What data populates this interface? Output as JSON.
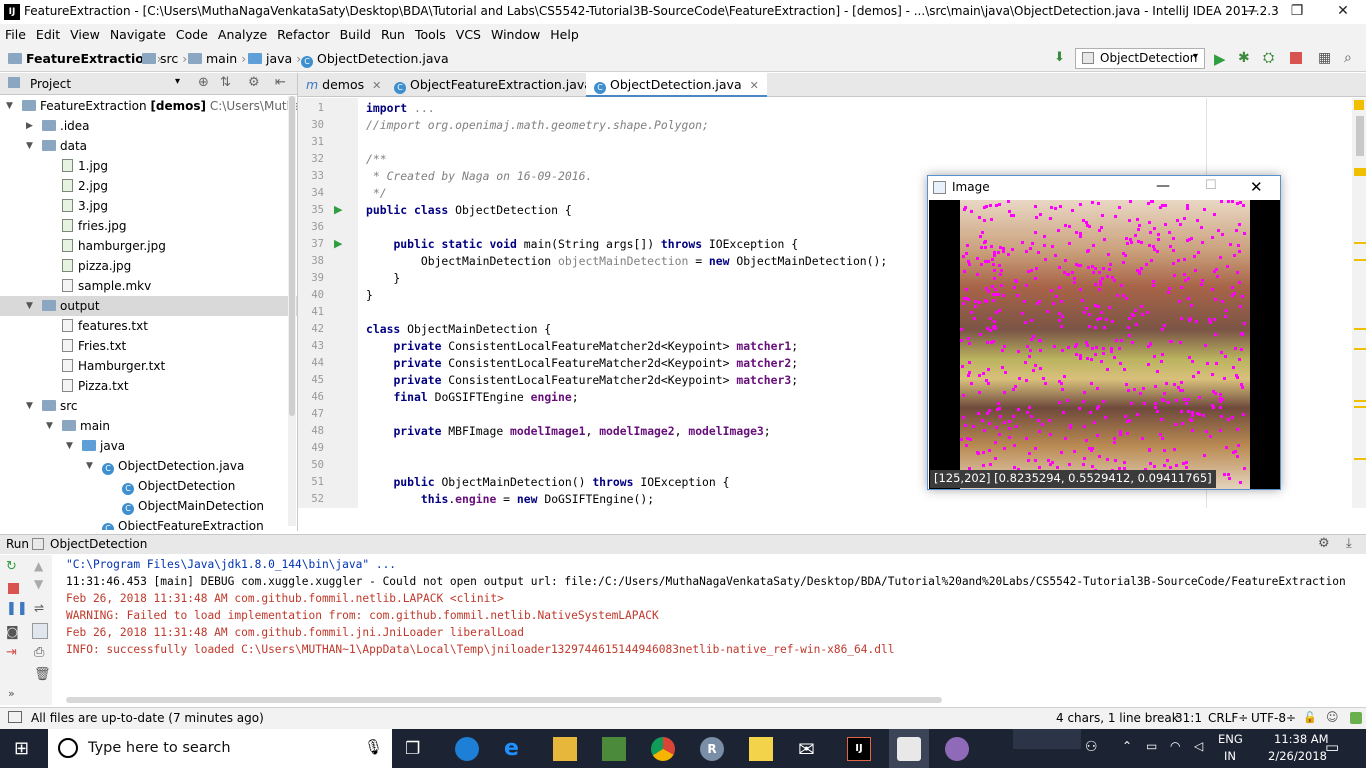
{
  "window": {
    "title": "FeatureExtraction - [C:\\Users\\MuthaNagaVenkataSaty\\Desktop\\BDA\\Tutorial and Labs\\CS5542-Tutorial3B-SourceCode\\FeatureExtraction] - [demos] - ...\\src\\main\\java\\ObjectDetection.java - IntelliJ IDEA 2017.2.3"
  },
  "menu": [
    "File",
    "Edit",
    "View",
    "Navigate",
    "Code",
    "Analyze",
    "Refactor",
    "Build",
    "Run",
    "Tools",
    "VCS",
    "Window",
    "Help"
  ],
  "breadcrumb": {
    "project": "FeatureExtraction",
    "parts": [
      "src",
      "main",
      "java"
    ],
    "file": "ObjectDetection.java"
  },
  "run_config": "ObjectDetection",
  "project_panel": {
    "title": "Project",
    "root_name": "FeatureExtraction",
    "root_module": "[demos]",
    "root_path": "C:\\Users\\MuthaNaga",
    "items": [
      {
        "label": ".idea",
        "type": "folder",
        "depth": 1,
        "expanded": false
      },
      {
        "label": "data",
        "type": "folder",
        "depth": 1,
        "expanded": true
      },
      {
        "label": "1.jpg",
        "type": "image",
        "depth": 2
      },
      {
        "label": "2.jpg",
        "type": "image",
        "depth": 2
      },
      {
        "label": "3.jpg",
        "type": "image",
        "depth": 2
      },
      {
        "label": "fries.jpg",
        "type": "image",
        "depth": 2
      },
      {
        "label": "hamburger.jpg",
        "type": "image",
        "depth": 2
      },
      {
        "label": "pizza.jpg",
        "type": "image",
        "depth": 2
      },
      {
        "label": "sample.mkv",
        "type": "file",
        "depth": 2
      },
      {
        "label": "output",
        "type": "folder",
        "depth": 1,
        "expanded": true,
        "selected": true
      },
      {
        "label": "features.txt",
        "type": "text",
        "depth": 2
      },
      {
        "label": "Fries.txt",
        "type": "text",
        "depth": 2
      },
      {
        "label": "Hamburger.txt",
        "type": "text",
        "depth": 2
      },
      {
        "label": "Pizza.txt",
        "type": "text",
        "depth": 2
      },
      {
        "label": "src",
        "type": "folder",
        "depth": 1,
        "expanded": true
      },
      {
        "label": "main",
        "type": "folder",
        "depth": 2,
        "expanded": true
      },
      {
        "label": "java",
        "type": "folder-blue",
        "depth": 3,
        "expanded": true
      },
      {
        "label": "ObjectDetection.java",
        "type": "class",
        "depth": 4,
        "expanded": true
      },
      {
        "label": "ObjectDetection",
        "type": "class",
        "depth": 5
      },
      {
        "label": "ObjectMainDetection",
        "type": "class",
        "depth": 5
      },
      {
        "label": "ObjectFeatureExtraction",
        "type": "class",
        "depth": 4
      }
    ]
  },
  "tabs": [
    {
      "label": "demos",
      "active": false
    },
    {
      "label": "ObjectFeatureExtraction.java",
      "active": false
    },
    {
      "label": "ObjectDetection.java",
      "active": true
    }
  ],
  "code": [
    {
      "n": "1",
      "html": "<span class=\"kw\">import</span> <span class=\"unused\">...</span>"
    },
    {
      "n": "30",
      "html": "<span class=\"cm\">//import org.openimaj.math.geometry.shape.Polygon;</span>"
    },
    {
      "n": "31",
      "html": ""
    },
    {
      "n": "32",
      "html": "<span class=\"cm\">/**</span>"
    },
    {
      "n": "33",
      "html": "<span class=\"cm\"> * Created by Naga on 16-09-2016.</span>"
    },
    {
      "n": "34",
      "html": "<span class=\"cm\"> */</span>"
    },
    {
      "n": "35",
      "html": "<span class=\"kw\">public class</span> ObjectDetection {"
    },
    {
      "n": "36",
      "html": ""
    },
    {
      "n": "37",
      "html": "    <span class=\"kw\">public static void</span> main(String args[]) <span class=\"kw\">throws</span> IOException {"
    },
    {
      "n": "38",
      "html": "        ObjectMainDetection <span class=\"unused\">objectMainDetection</span> = <span class=\"kw\">new</span> ObjectMainDetection();"
    },
    {
      "n": "39",
      "html": "    }"
    },
    {
      "n": "40",
      "html": "}"
    },
    {
      "n": "41",
      "html": ""
    },
    {
      "n": "42",
      "html": "<span class=\"kw\">class</span> ObjectMainDetection {"
    },
    {
      "n": "43",
      "html": "    <span class=\"kw\">private</span> ConsistentLocalFeatureMatcher2d&lt;Keypoint&gt; <span class=\"fld\">matcher1</span>;"
    },
    {
      "n": "44",
      "html": "    <span class=\"kw\">private</span> ConsistentLocalFeatureMatcher2d&lt;Keypoint&gt; <span class=\"fld\">matcher2</span>;"
    },
    {
      "n": "45",
      "html": "    <span class=\"kw\">private</span> ConsistentLocalFeatureMatcher2d&lt;Keypoint&gt; <span class=\"fld\">matcher3</span>;"
    },
    {
      "n": "46",
      "html": "    <span class=\"kw\">final</span> DoGSIFTEngine <span class=\"fld\">engine</span>;"
    },
    {
      "n": "47",
      "html": ""
    },
    {
      "n": "48",
      "html": "    <span class=\"kw\">private</span> MBFImage <span class=\"fld\">modelImage1</span>, <span class=\"fld\">modelImage2</span>, <span class=\"fld\">modelImage3</span>;"
    },
    {
      "n": "49",
      "html": ""
    },
    {
      "n": "50",
      "html": ""
    },
    {
      "n": "51",
      "html": "    <span class=\"kw\">public</span> ObjectMainDetection() <span class=\"kw\">throws</span> IOException {"
    },
    {
      "n": "52",
      "html": "        <span class=\"kw\">this</span>.<span class=\"fld\">engine</span> = <span class=\"kw\">new</span> DoGSIFTEngine();"
    }
  ],
  "image_window": {
    "title": "Image",
    "pixel_info": "[125,202] [0.8235294, 0.5529412, 0.09411765]"
  },
  "run_panel": {
    "label": "Run",
    "config": "ObjectDetection",
    "lines": [
      {
        "text": "\"C:\\Program Files\\Java\\jdk1.8.0_144\\bin\\java\" ...",
        "color": "#0033b3"
      },
      {
        "text": "11:31:46.453 [main] DEBUG com.xuggle.xuggler - Could not open output url: file:/C:/Users/MuthaNagaVenkataSaty/Desktop/BDA/Tutorial%20and%20Labs/CS5542-Tutorial3B-SourceCode/FeatureExtraction",
        "color": "#000000"
      },
      {
        "text": "Feb 26, 2018 11:31:48 AM com.github.fommil.netlib.LAPACK <clinit>",
        "color": "#c0392b"
      },
      {
        "text": "WARNING: Failed to load implementation from: com.github.fommil.netlib.NativeSystemLAPACK",
        "color": "#c0392b"
      },
      {
        "text": "Feb 26, 2018 11:31:48 AM com.github.fommil.jni.JniLoader liberalLoad",
        "color": "#c0392b"
      },
      {
        "text": "INFO: successfully loaded C:\\Users\\MUTHAN~1\\AppData\\Local\\Temp\\jniloader1329744615144946083netlib-native_ref-win-x86_64.dll",
        "color": "#c0392b"
      }
    ]
  },
  "status": {
    "message": "All files are up-to-date (7 minutes ago)",
    "selection": "4 chars, 1 line break",
    "position": "31:1",
    "line_sep": "CRLF÷",
    "encoding": "UTF-8÷"
  },
  "taskbar": {
    "search_placeholder": "Type here to search",
    "lang": "ENG",
    "region": "IN",
    "time": "11:38 AM",
    "date": "2/26/2018"
  },
  "colors": {
    "selection_blue": "#6f8fc0",
    "keyword": "#000080",
    "error_text": "#c0392b",
    "taskbar": "#1c2433"
  }
}
